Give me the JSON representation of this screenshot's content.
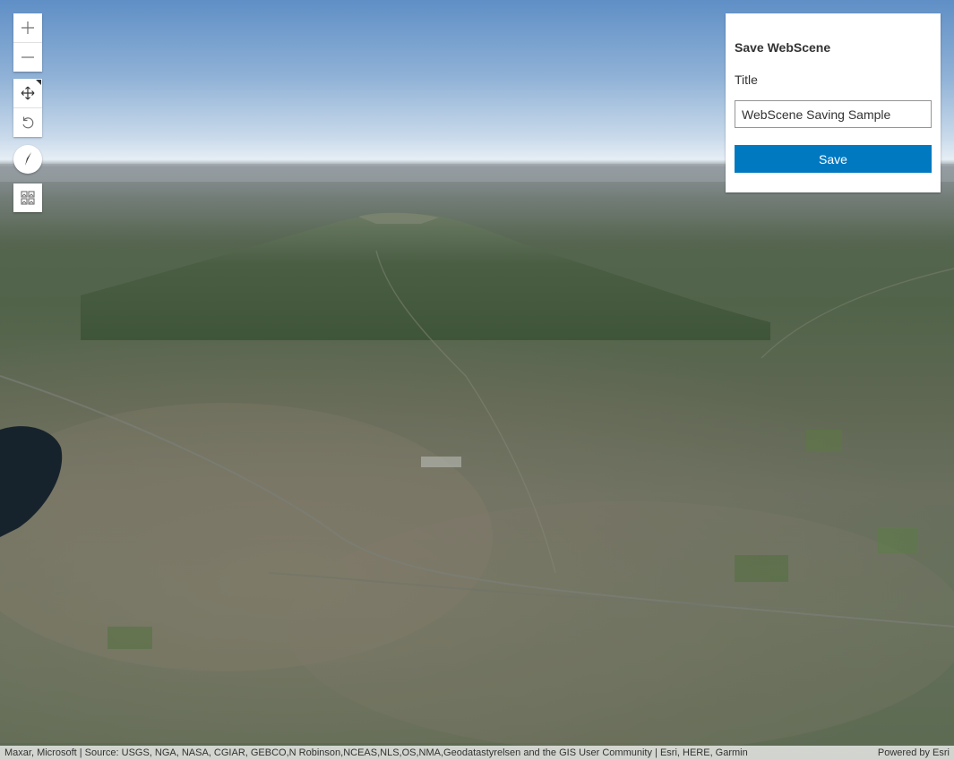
{
  "map": {
    "place_labels": []
  },
  "controls": {
    "zoom_in": "zoom-in",
    "zoom_out": "zoom-out",
    "pan": "pan",
    "rotate": "rotate",
    "compass": "compass",
    "layer_list": "basemap-toggle"
  },
  "panel": {
    "heading": "Save WebScene",
    "title_label": "Title",
    "title_value": "WebScene Saving Sample",
    "save_label": "Save"
  },
  "attribution": {
    "sources": "Maxar, Microsoft | Source: USGS, NGA, NASA, CGIAR, GEBCO,N Robinson,NCEAS,NLS,OS,NMA,Geodatastyrelsen and the GIS User Community | Esri, HERE, Garmin",
    "powered_by": "Powered by Esri"
  },
  "colors": {
    "button_blue": "#0079c1",
    "sky_top": "#5f8fc6",
    "terrain_green": "#51644a"
  }
}
